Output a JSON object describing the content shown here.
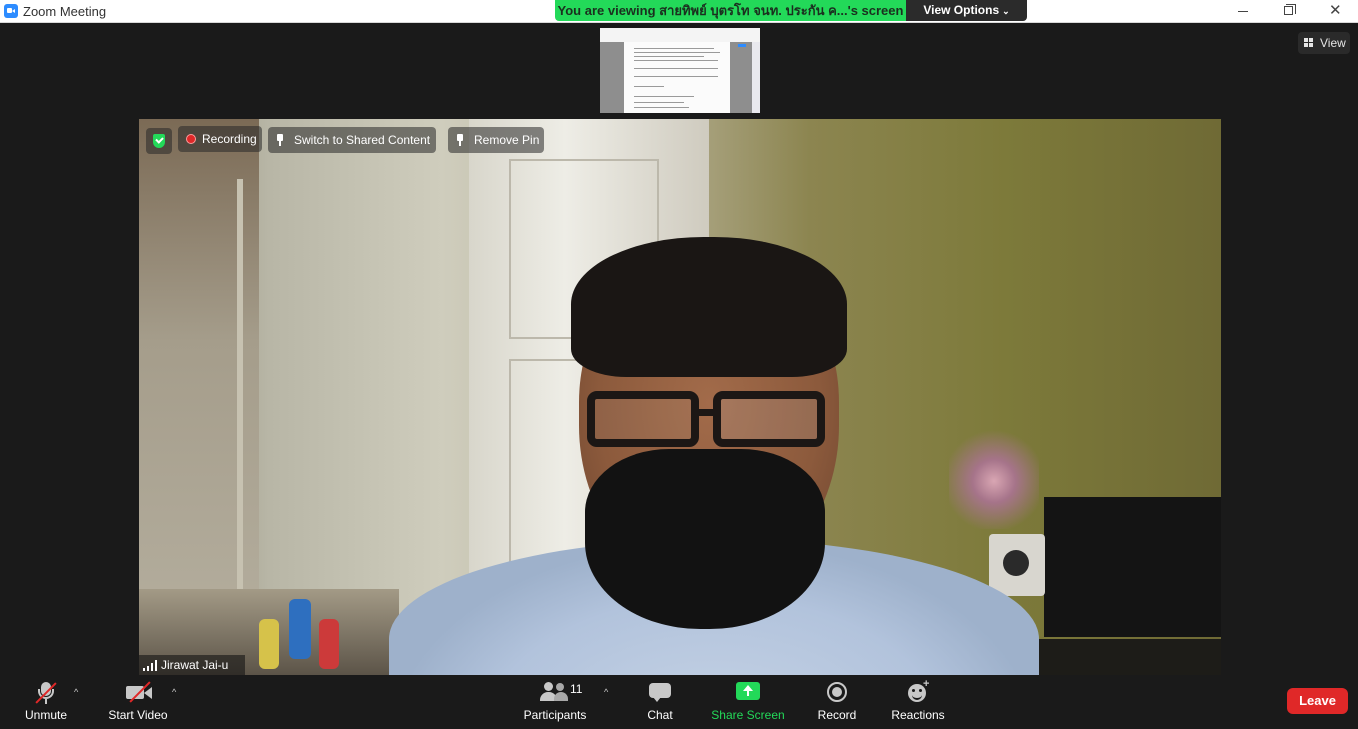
{
  "window": {
    "title": "Zoom Meeting",
    "app_icon": "zoom-camera-icon",
    "controls": [
      "minimize-icon",
      "maximize-icon",
      "close-icon"
    ]
  },
  "banner": {
    "viewing_text": "You are viewing สายทิพย์ บุตรโท จนท. ประกัน ค...'s screen",
    "view_options_label": "View Options",
    "accent_color": "#23d959"
  },
  "top_right": {
    "view_label": "View"
  },
  "video": {
    "recording_label": "Recording",
    "switch_label": "Switch to Shared Content",
    "remove_pin_label": "Remove Pin",
    "participant_name": "Jirawat Jai-u",
    "encryption_icon": "shield-check-icon"
  },
  "toolbar": {
    "unmute_label": "Unmute",
    "start_video_label": "Start Video",
    "participants_label": "Participants",
    "participants_count": "11",
    "chat_label": "Chat",
    "share_screen_label": "Share Screen",
    "record_label": "Record",
    "reactions_label": "Reactions",
    "leave_label": "Leave",
    "leave_color": "#e02828"
  }
}
